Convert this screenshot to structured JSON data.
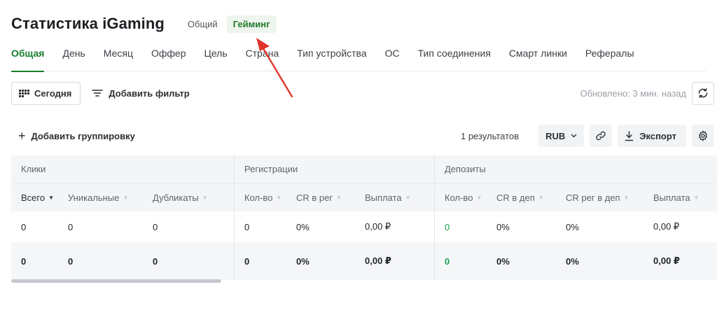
{
  "header": {
    "title": "Статистика iGaming",
    "modes": [
      {
        "label": "Общий",
        "active": false
      },
      {
        "label": "Гейминг",
        "active": true
      }
    ]
  },
  "tabs": [
    {
      "label": "Общая",
      "active": true
    },
    {
      "label": "День"
    },
    {
      "label": "Месяц"
    },
    {
      "label": "Оффер"
    },
    {
      "label": "Цель"
    },
    {
      "label": "Страна"
    },
    {
      "label": "Тип устройства"
    },
    {
      "label": "ОС"
    },
    {
      "label": "Тип соединения"
    },
    {
      "label": "Смарт линки"
    },
    {
      "label": "Рефералы"
    }
  ],
  "toolbar": {
    "date_button": "Сегодня",
    "add_filter": "Добавить фильтр",
    "updated": "Обновлено: 3 мин. назад"
  },
  "actions": {
    "add_grouping": "Добавить группировку",
    "results": "1 результатов",
    "currency": "RUB",
    "export": "Экспорт"
  },
  "table": {
    "groups": [
      "Клики",
      "Регистрации",
      "Депозиты"
    ],
    "columns": [
      "Всего",
      "Уникальные",
      "Дубликаты",
      "Кол-во",
      "CR в рег",
      "Выплата",
      "Кол-во",
      "CR в деп",
      "CR рег в деп",
      "Выплата"
    ],
    "rows": [
      [
        "0",
        "0",
        "0",
        "0",
        "0%",
        "0,00 ₽",
        "0",
        "0%",
        "0%",
        "0,00 ₽"
      ],
      [
        "0",
        "0",
        "0",
        "0",
        "0%",
        "0,00 ₽",
        "0",
        "0%",
        "0%",
        "0,00 ₽"
      ]
    ]
  },
  "colors": {
    "accent": "#1a7f2c",
    "annotation_arrow": "#e0342b",
    "deposit_count": "#1aa352"
  }
}
